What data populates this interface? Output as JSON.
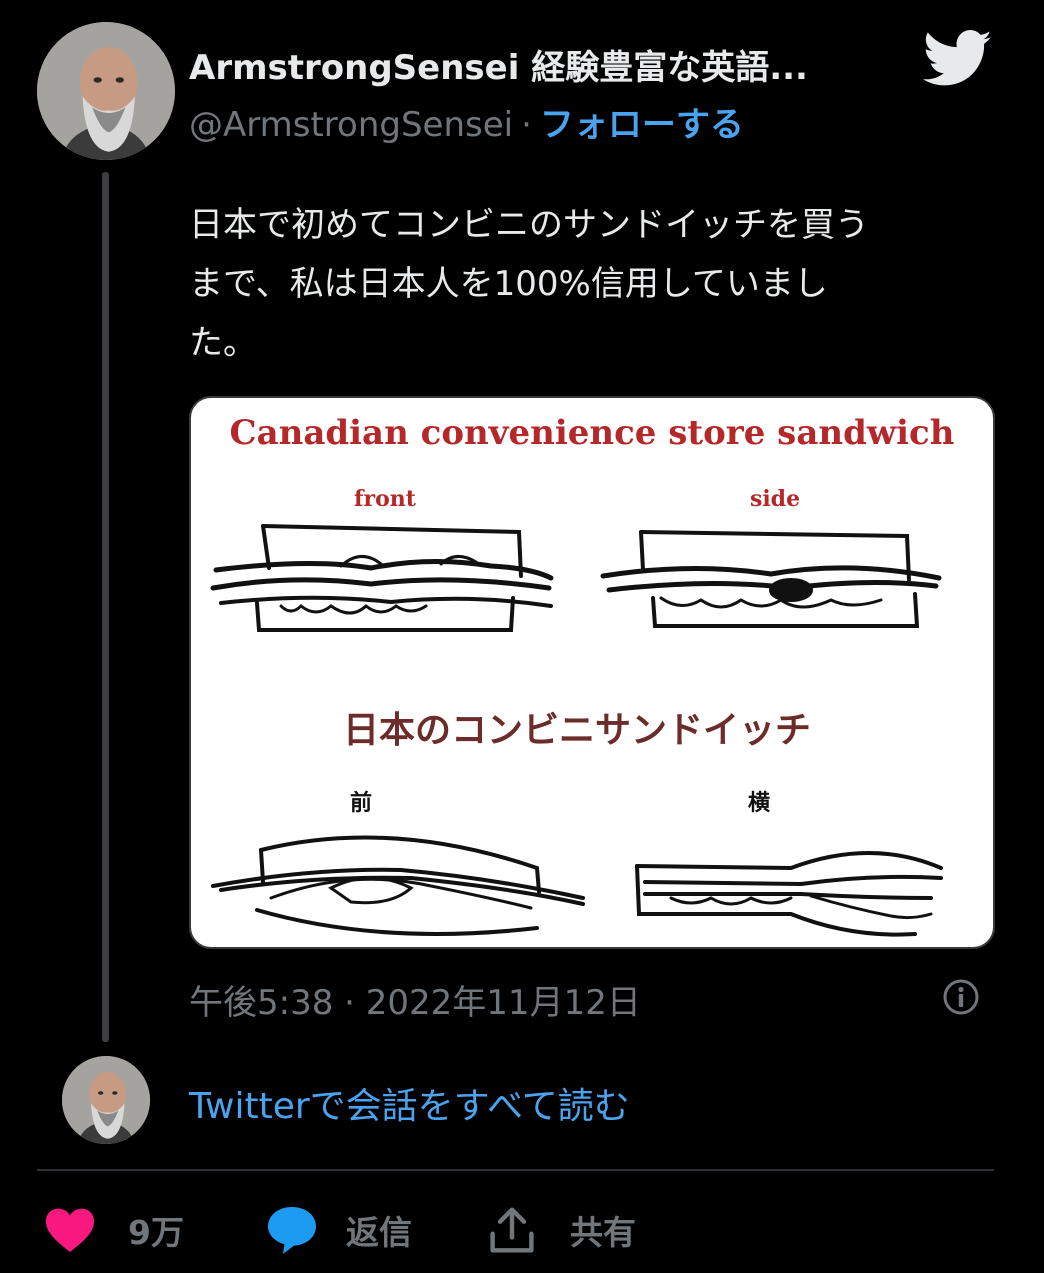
{
  "tweet": {
    "author_name": "ArmstrongSensei 経験豊富な英語...",
    "handle": "@ArmstrongSensei",
    "separator": "·",
    "follow_label": "フォローする",
    "text": "日本で初めてコンビニのサンドイッチを買う\nまで、私は日本人を100%信用していまし\nた。",
    "timestamp": "午後5:38 · 2022年11月12日",
    "read_all_label": "Twitterで会話をすべて読む"
  },
  "media": {
    "title_top": "Canadian convenience store sandwich",
    "label_front": "front",
    "label_side": "side",
    "title_bottom": "日本のコンビニサンドイッチ",
    "label_mae": "前",
    "label_yoko": "横"
  },
  "actions": {
    "like_count": "9万",
    "reply_label": "返信",
    "share_label": "共有"
  },
  "icons": {
    "brand": "twitter-bird-icon",
    "info": "info-icon",
    "like": "heart-icon",
    "reply": "speech-bubble-icon",
    "share": "share-icon"
  },
  "colors": {
    "background": "#000000",
    "link": "#4aa3ef",
    "secondary_text": "#71767b",
    "like_pink": "#f91880",
    "reply_blue": "#1d9bf0",
    "illustration_title": "#b5282a",
    "illustration_subtitle": "#6b2c2a"
  }
}
